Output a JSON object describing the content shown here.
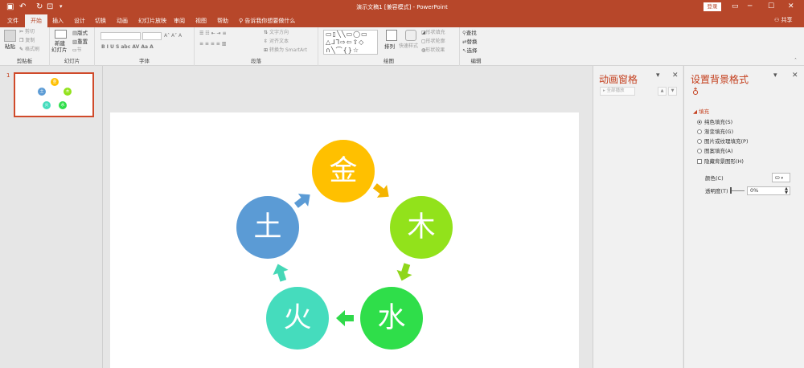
{
  "titlebar": {
    "title": "演示文稿1 [兼容模式] - PowerPoint",
    "login": "登录"
  },
  "tabs": [
    {
      "label": "文件"
    },
    {
      "label": "开始"
    },
    {
      "label": "插入"
    },
    {
      "label": "设计"
    },
    {
      "label": "切换"
    },
    {
      "label": "动画"
    },
    {
      "label": "幻灯片放映"
    },
    {
      "label": "审阅"
    },
    {
      "label": "视图"
    },
    {
      "label": "帮助"
    }
  ],
  "tellme": "告诉我你想要做什么",
  "share": "共享",
  "ribbon": {
    "clipboard": {
      "label": "剪贴板",
      "paste": "粘贴",
      "cut": "剪切",
      "copy": "复制",
      "painter": "格式刷"
    },
    "slides": {
      "label": "幻灯片",
      "new_slide": "新建",
      "new_slide2": "幻灯片",
      "layout": "版式",
      "reset": "重置",
      "section": "节"
    },
    "font": {
      "label": "字体"
    },
    "paragraph": {
      "label": "段落",
      "text_dir": "文字方向",
      "align_text": "对齐文本",
      "smartart": "转换为 SmartArt"
    },
    "drawing": {
      "label": "绘图",
      "arrange": "排列",
      "quick_styles": "快速样式",
      "fill": "形状填充",
      "outline": "形状轮廓",
      "effects": "形状效果"
    },
    "editing": {
      "label": "编辑",
      "find": "查找",
      "replace": "替换",
      "select": "选择"
    }
  },
  "slide_number": "1",
  "diagram": {
    "nodes": [
      {
        "label": "金",
        "color": "#ffc000"
      },
      {
        "label": "木",
        "color": "#92e21b"
      },
      {
        "label": "水",
        "color": "#2fde4a"
      },
      {
        "label": "火",
        "color": "#45dcbd"
      },
      {
        "label": "土",
        "color": "#5b9bd5"
      }
    ]
  },
  "anim_pane": {
    "title": "动画窗格",
    "play": "全部播放"
  },
  "bg_pane": {
    "title": "设置背景格式",
    "section": "填充",
    "options": [
      {
        "label": "纯色填充(S)",
        "selected": true
      },
      {
        "label": "渐变填充(G)",
        "selected": false
      },
      {
        "label": "图片或纹理填充(P)",
        "selected": false
      },
      {
        "label": "图案填充(A)",
        "selected": false
      }
    ],
    "hide_graphics": "隐藏背景图形(H)",
    "color_label": "颜色(C)",
    "transparency_label": "透明度(T)",
    "transparency_value": "0%"
  }
}
